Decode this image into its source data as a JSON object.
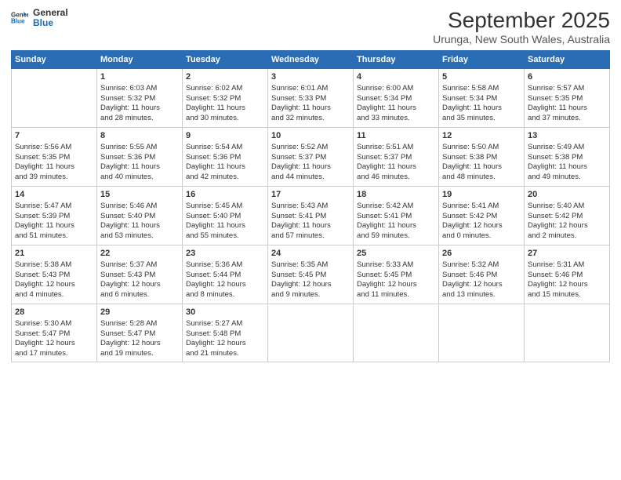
{
  "header": {
    "logo_line1": "General",
    "logo_line2": "Blue",
    "month": "September 2025",
    "location": "Urunga, New South Wales, Australia"
  },
  "days_of_week": [
    "Sunday",
    "Monday",
    "Tuesday",
    "Wednesday",
    "Thursday",
    "Friday",
    "Saturday"
  ],
  "weeks": [
    [
      {
        "day": "",
        "info": ""
      },
      {
        "day": "1",
        "info": "Sunrise: 6:03 AM\nSunset: 5:32 PM\nDaylight: 11 hours\nand 28 minutes."
      },
      {
        "day": "2",
        "info": "Sunrise: 6:02 AM\nSunset: 5:32 PM\nDaylight: 11 hours\nand 30 minutes."
      },
      {
        "day": "3",
        "info": "Sunrise: 6:01 AM\nSunset: 5:33 PM\nDaylight: 11 hours\nand 32 minutes."
      },
      {
        "day": "4",
        "info": "Sunrise: 6:00 AM\nSunset: 5:34 PM\nDaylight: 11 hours\nand 33 minutes."
      },
      {
        "day": "5",
        "info": "Sunrise: 5:58 AM\nSunset: 5:34 PM\nDaylight: 11 hours\nand 35 minutes."
      },
      {
        "day": "6",
        "info": "Sunrise: 5:57 AM\nSunset: 5:35 PM\nDaylight: 11 hours\nand 37 minutes."
      }
    ],
    [
      {
        "day": "7",
        "info": "Sunrise: 5:56 AM\nSunset: 5:35 PM\nDaylight: 11 hours\nand 39 minutes."
      },
      {
        "day": "8",
        "info": "Sunrise: 5:55 AM\nSunset: 5:36 PM\nDaylight: 11 hours\nand 40 minutes."
      },
      {
        "day": "9",
        "info": "Sunrise: 5:54 AM\nSunset: 5:36 PM\nDaylight: 11 hours\nand 42 minutes."
      },
      {
        "day": "10",
        "info": "Sunrise: 5:52 AM\nSunset: 5:37 PM\nDaylight: 11 hours\nand 44 minutes."
      },
      {
        "day": "11",
        "info": "Sunrise: 5:51 AM\nSunset: 5:37 PM\nDaylight: 11 hours\nand 46 minutes."
      },
      {
        "day": "12",
        "info": "Sunrise: 5:50 AM\nSunset: 5:38 PM\nDaylight: 11 hours\nand 48 minutes."
      },
      {
        "day": "13",
        "info": "Sunrise: 5:49 AM\nSunset: 5:38 PM\nDaylight: 11 hours\nand 49 minutes."
      }
    ],
    [
      {
        "day": "14",
        "info": "Sunrise: 5:47 AM\nSunset: 5:39 PM\nDaylight: 11 hours\nand 51 minutes."
      },
      {
        "day": "15",
        "info": "Sunrise: 5:46 AM\nSunset: 5:40 PM\nDaylight: 11 hours\nand 53 minutes."
      },
      {
        "day": "16",
        "info": "Sunrise: 5:45 AM\nSunset: 5:40 PM\nDaylight: 11 hours\nand 55 minutes."
      },
      {
        "day": "17",
        "info": "Sunrise: 5:43 AM\nSunset: 5:41 PM\nDaylight: 11 hours\nand 57 minutes."
      },
      {
        "day": "18",
        "info": "Sunrise: 5:42 AM\nSunset: 5:41 PM\nDaylight: 11 hours\nand 59 minutes."
      },
      {
        "day": "19",
        "info": "Sunrise: 5:41 AM\nSunset: 5:42 PM\nDaylight: 12 hours\nand 0 minutes."
      },
      {
        "day": "20",
        "info": "Sunrise: 5:40 AM\nSunset: 5:42 PM\nDaylight: 12 hours\nand 2 minutes."
      }
    ],
    [
      {
        "day": "21",
        "info": "Sunrise: 5:38 AM\nSunset: 5:43 PM\nDaylight: 12 hours\nand 4 minutes."
      },
      {
        "day": "22",
        "info": "Sunrise: 5:37 AM\nSunset: 5:43 PM\nDaylight: 12 hours\nand 6 minutes."
      },
      {
        "day": "23",
        "info": "Sunrise: 5:36 AM\nSunset: 5:44 PM\nDaylight: 12 hours\nand 8 minutes."
      },
      {
        "day": "24",
        "info": "Sunrise: 5:35 AM\nSunset: 5:45 PM\nDaylight: 12 hours\nand 9 minutes."
      },
      {
        "day": "25",
        "info": "Sunrise: 5:33 AM\nSunset: 5:45 PM\nDaylight: 12 hours\nand 11 minutes."
      },
      {
        "day": "26",
        "info": "Sunrise: 5:32 AM\nSunset: 5:46 PM\nDaylight: 12 hours\nand 13 minutes."
      },
      {
        "day": "27",
        "info": "Sunrise: 5:31 AM\nSunset: 5:46 PM\nDaylight: 12 hours\nand 15 minutes."
      }
    ],
    [
      {
        "day": "28",
        "info": "Sunrise: 5:30 AM\nSunset: 5:47 PM\nDaylight: 12 hours\nand 17 minutes."
      },
      {
        "day": "29",
        "info": "Sunrise: 5:28 AM\nSunset: 5:47 PM\nDaylight: 12 hours\nand 19 minutes."
      },
      {
        "day": "30",
        "info": "Sunrise: 5:27 AM\nSunset: 5:48 PM\nDaylight: 12 hours\nand 21 minutes."
      },
      {
        "day": "",
        "info": ""
      },
      {
        "day": "",
        "info": ""
      },
      {
        "day": "",
        "info": ""
      },
      {
        "day": "",
        "info": ""
      }
    ]
  ]
}
